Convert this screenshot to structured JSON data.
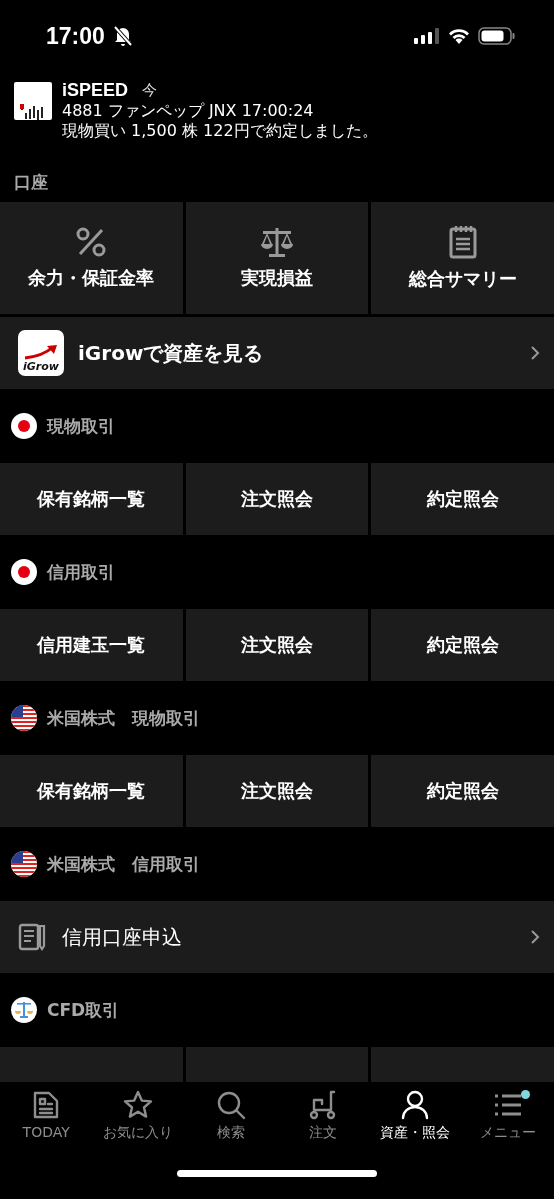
{
  "status_bar": {
    "time": "17:00",
    "silent": true
  },
  "notification": {
    "app": "iSPEED",
    "time": "今",
    "line_1": "4881 ファンペップ JNX 17:00:24",
    "line_2": "現物買い 1,500 株 122円で約定しました。"
  },
  "account": {
    "label": "口座",
    "tiles": [
      "余力・保証金率",
      "実現損益",
      "総合サマリー"
    ],
    "igrow": {
      "logo_text": "iGrow",
      "label": "iGrowで資産を見る"
    }
  },
  "sections": [
    {
      "title": "現物取引",
      "kind": "grid",
      "items": [
        "保有銘柄一覧",
        "注文照会",
        "約定照会"
      ]
    },
    {
      "title": "信用取引",
      "kind": "grid",
      "items": [
        "信用建玉一覧",
        "注文照会",
        "約定照会"
      ]
    },
    {
      "title": "米国株式　現物取引",
      "kind": "grid",
      "items": [
        "保有銘柄一覧",
        "注文照会",
        "約定照会"
      ]
    },
    {
      "title": "米国株式　信用取引",
      "kind": "link",
      "label": "信用口座申込"
    },
    {
      "title": "CFD取引",
      "kind": "hidden_grid"
    }
  ],
  "tab_bar": [
    {
      "label": "TODAY",
      "selected": false,
      "badge": false
    },
    {
      "label": "お気に入り",
      "selected": false,
      "badge": false
    },
    {
      "label": "検索",
      "selected": false,
      "badge": false
    },
    {
      "label": "注文",
      "selected": false,
      "badge": false
    },
    {
      "label": "資産・照会",
      "selected": true,
      "badge": false
    },
    {
      "label": "メニュー",
      "selected": false,
      "badge": true
    }
  ]
}
